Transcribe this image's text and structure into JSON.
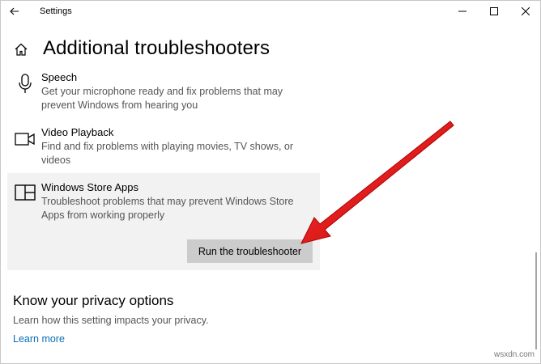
{
  "window": {
    "app_title": "Settings"
  },
  "header": {
    "title": "Additional troubleshooters"
  },
  "troubleshooters": [
    {
      "name": "Speech",
      "description": "Get your microphone ready and fix problems that may prevent Windows from hearing you",
      "icon": "microphone-icon"
    },
    {
      "name": "Video Playback",
      "description": "Find and fix problems with playing movies, TV shows, or videos",
      "icon": "video-camera-icon"
    },
    {
      "name": "Windows Store Apps",
      "description": "Troubleshoot problems that may prevent Windows Store Apps from working properly",
      "icon": "store-apps-icon",
      "selected": true,
      "button_label": "Run the troubleshooter"
    }
  ],
  "privacy": {
    "heading": "Know your privacy options",
    "text": "Learn how this setting impacts your privacy.",
    "link": "Learn more"
  },
  "colors": {
    "selected_background": "#f2f2f2",
    "button_background": "#cccccc",
    "link": "#0a6fb2",
    "annotation_arrow": "#e0151c"
  },
  "watermark": "wsxdn.com"
}
